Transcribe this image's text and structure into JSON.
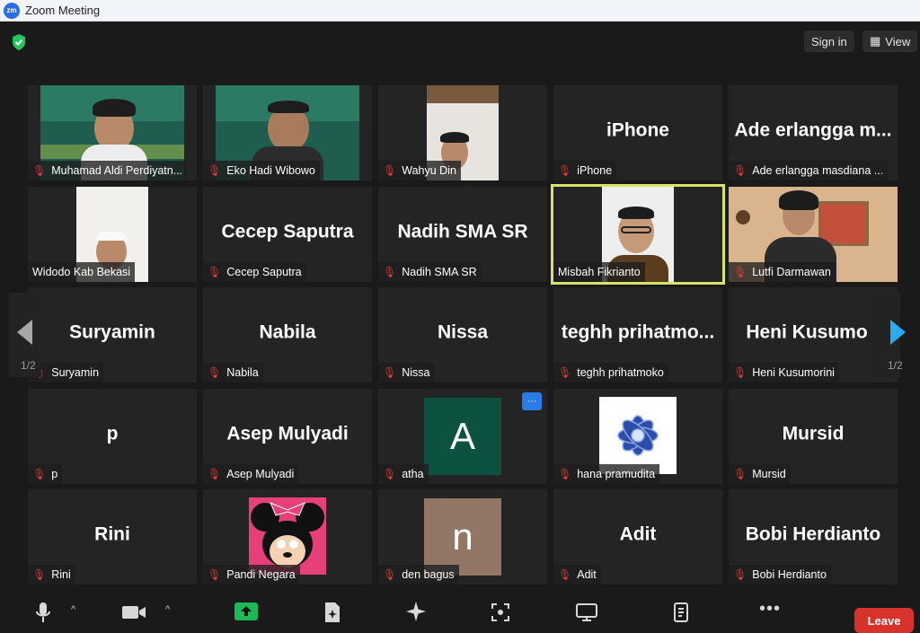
{
  "window": {
    "title": "Zoom Meeting",
    "logo_text": "zm"
  },
  "topbar": {
    "sign_in_label": "Sign in",
    "view_label": "View"
  },
  "pagination": {
    "left_page": "1/2",
    "right_page": "1/2"
  },
  "tiles": [
    {
      "name": "Muhamad Aldi Perdiyatn...",
      "big": ""
    },
    {
      "name": "Eko Hadi Wibowo",
      "big": ""
    },
    {
      "name": "Wahyu Din",
      "big": ""
    },
    {
      "name": "iPhone",
      "big": "iPhone"
    },
    {
      "name": "Ade erlangga masdiana ...",
      "big": "Ade erlangga m..."
    },
    {
      "name": "Widodo Kab Bekasi",
      "big": ""
    },
    {
      "name": "Cecep Saputra",
      "big": "Cecep Saputra"
    },
    {
      "name": "Nadih SMA SR",
      "big": "Nadih SMA SR"
    },
    {
      "name": "Misbah Fikrianto",
      "big": ""
    },
    {
      "name": "Lutfi Darmawan",
      "big": ""
    },
    {
      "name": "Suryamin",
      "big": "Suryamin"
    },
    {
      "name": "Nabila",
      "big": "Nabila"
    },
    {
      "name": "Nissa",
      "big": "Nissa"
    },
    {
      "name": "teghh prihatmoko",
      "big": "teghh  prihatmo..."
    },
    {
      "name": "Heni Kusumorini",
      "big": "Heni Kusumori"
    },
    {
      "name": "p",
      "big": "p"
    },
    {
      "name": "Asep Mulyadi",
      "big": "Asep Mulyadi"
    },
    {
      "name": "atha",
      "big": "",
      "avatar": "A"
    },
    {
      "name": "hana pramudita",
      "big": ""
    },
    {
      "name": "Mursid",
      "big": "Mursid"
    },
    {
      "name": "Rini",
      "big": "Rini"
    },
    {
      "name": "Pandi Negara",
      "big": ""
    },
    {
      "name": "den bagus",
      "big": "",
      "avatar": "n"
    },
    {
      "name": "Adit",
      "big": "Adit"
    },
    {
      "name": "Bobi Herdianto",
      "big": "Bobi Herdianto"
    }
  ],
  "more_options_glyph": "···",
  "toolbar": {
    "leave_label": "Leave"
  },
  "colors": {
    "active_speaker": "#d7e26b",
    "leave": "#d8322d",
    "share": "#1db954",
    "muted": "#e23b3b"
  }
}
